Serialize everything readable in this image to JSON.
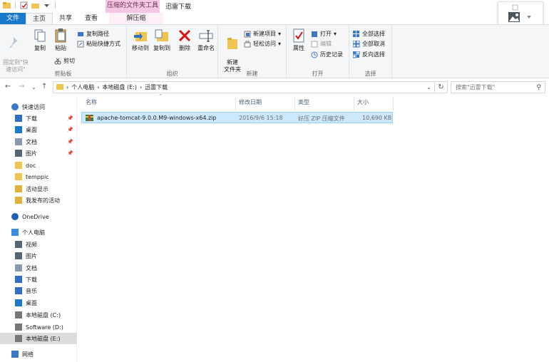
{
  "titlebar": {
    "context_tool_label": "压缩的文件夹工具",
    "window_title": "迅雷下载",
    "qat_separator": "|"
  },
  "tabs": {
    "file": "文件",
    "home": "主页",
    "share": "共享",
    "view": "查看",
    "extract": "解压缩"
  },
  "ribbon": {
    "clipboard": {
      "pin_quick": "固定到\"快\n速访问\"",
      "copy": "复制",
      "paste": "粘贴",
      "copy_path": "复制路径",
      "paste_shortcut": "粘贴快捷方式",
      "cut": "剪切",
      "label": "剪贴板"
    },
    "organize": {
      "move_to": "移动到",
      "copy_to": "复制到",
      "delete": "删除",
      "rename": "重命名",
      "label": "组织"
    },
    "new": {
      "new_folder": "新建\n文件夹",
      "new_item": "新建项目",
      "easy_access": "轻松访问",
      "label": "新建"
    },
    "open": {
      "properties": "属性",
      "open": "打开",
      "edit": "编辑",
      "history": "历史记录",
      "label": "打开"
    },
    "select": {
      "select_all": "全部选择",
      "select_none": "全部取消",
      "invert": "反向选择",
      "label": "选择"
    }
  },
  "address": {
    "crumbs": [
      "个人电脑",
      "本地磁盘 (E:)",
      "迅雷下载"
    ],
    "search_placeholder": "搜索\"迅雷下载\""
  },
  "nav": {
    "items": [
      {
        "label": "快速访问",
        "icon": "star-icon",
        "level": 0
      },
      {
        "label": "下载",
        "icon": "download-icon",
        "level": 1,
        "pinned": true
      },
      {
        "label": "桌面",
        "icon": "desktop-icon",
        "level": 1,
        "pinned": true
      },
      {
        "label": "文档",
        "icon": "document-icon",
        "level": 1,
        "pinned": true
      },
      {
        "label": "图片",
        "icon": "picture-icon",
        "level": 1,
        "pinned": true
      },
      {
        "label": "doc",
        "icon": "folder-icon",
        "level": 1
      },
      {
        "label": "temppic",
        "icon": "folder-icon",
        "level": 1
      },
      {
        "label": "活动显示",
        "icon": "folder-check-icon",
        "level": 1
      },
      {
        "label": "我发布的活动",
        "icon": "folder-check-icon",
        "level": 1
      },
      {
        "label": "OneDrive",
        "icon": "cloud-icon",
        "level": 0
      },
      {
        "label": "个人电脑",
        "icon": "pc-icon",
        "level": 0
      },
      {
        "label": "视频",
        "icon": "video-icon",
        "level": 1
      },
      {
        "label": "图片",
        "icon": "picture-icon",
        "level": 1
      },
      {
        "label": "文档",
        "icon": "document-icon",
        "level": 1
      },
      {
        "label": "下载",
        "icon": "download-icon",
        "level": 1
      },
      {
        "label": "音乐",
        "icon": "music-icon",
        "level": 1
      },
      {
        "label": "桌面",
        "icon": "desktop-icon",
        "level": 1
      },
      {
        "label": "本地磁盘 (C:)",
        "icon": "drive-icon",
        "level": 1
      },
      {
        "label": "Software (D:)",
        "icon": "drive-icon",
        "level": 1
      },
      {
        "label": "本地磁盘 (E:)",
        "icon": "drive-icon",
        "level": 1,
        "selected": true
      },
      {
        "label": "网络",
        "icon": "network-icon",
        "level": 0
      }
    ]
  },
  "columns": {
    "name": "名称",
    "modified": "修改日期",
    "type": "类型",
    "size": "大小"
  },
  "files": [
    {
      "name": "apache-tomcat-9.0.0.M9-windows-x64.zip",
      "modified": "2016/9/6 15:18",
      "type": "好压 ZIP 压缩文件",
      "size": "10,690 KB"
    }
  ],
  "colors": {
    "file_tab": "#1979ca",
    "context_tab": "#f6c7e5",
    "selection": "#cce8ff",
    "folder": "#f0c451"
  }
}
